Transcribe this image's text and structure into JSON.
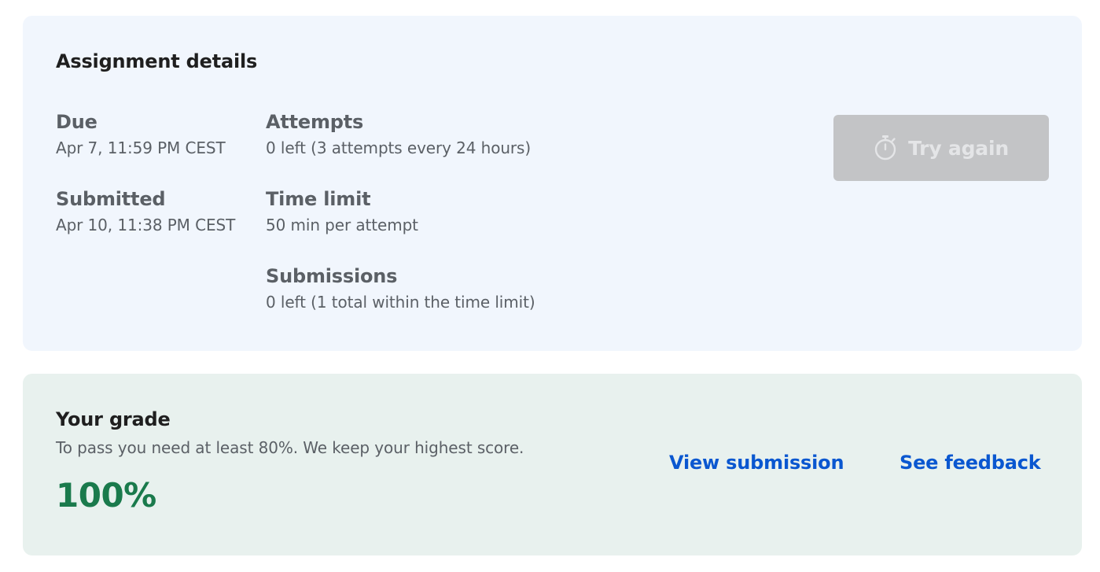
{
  "details": {
    "title": "Assignment details",
    "due_label": "Due",
    "due_value": "Apr 7, 11:59 PM CEST",
    "submitted_label": "Submitted",
    "submitted_value": "Apr 10, 11:38 PM CEST",
    "attempts_label": "Attempts",
    "attempts_value": "0 left (3 attempts every 24 hours)",
    "time_limit_label": "Time limit",
    "time_limit_value": "50 min per attempt",
    "submissions_label": "Submissions",
    "submissions_value": "0 left (1 total within the time limit)",
    "try_again_label": "Try again",
    "try_again_icon": "stopwatch-icon"
  },
  "grade": {
    "title": "Your grade",
    "hint": "To pass you need at least 80%. We keep your highest score.",
    "score": "100%",
    "view_submission_label": "View submission",
    "see_feedback_label": "See feedback"
  },
  "colors": {
    "details_bg": "#f1f6fd",
    "grade_bg": "#e8f1ee",
    "score_green": "#1a7a4c",
    "link_blue": "#0a57d0",
    "disabled_button": "#c3c4c6"
  }
}
